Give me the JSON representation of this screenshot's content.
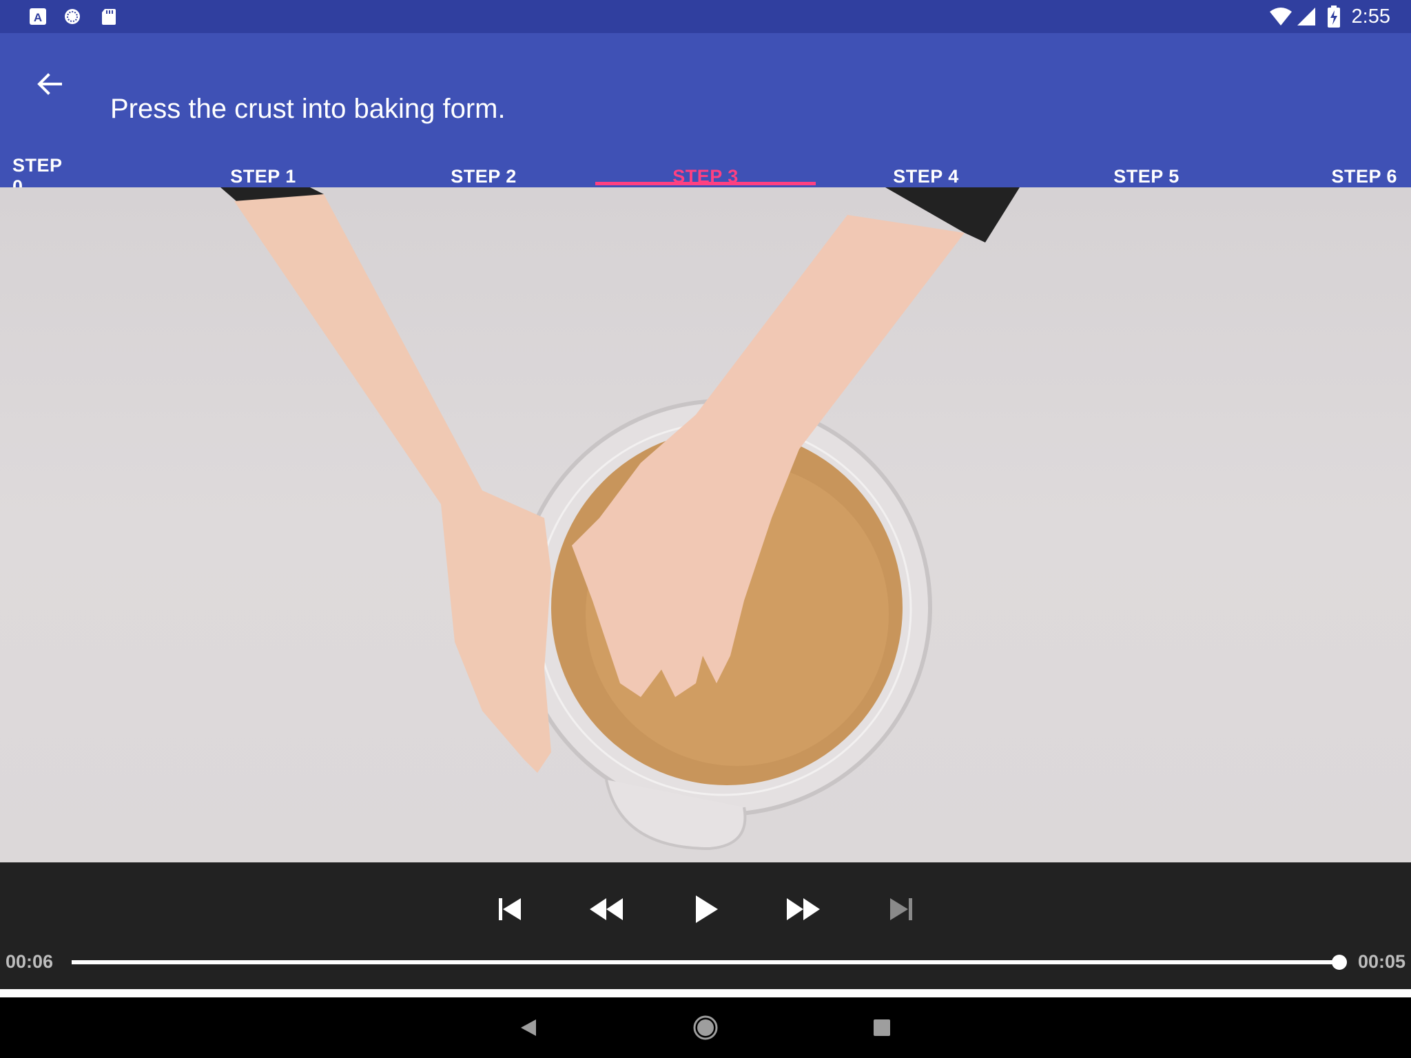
{
  "status_bar": {
    "time": "2:55",
    "left_icons": [
      "a-icon",
      "sync-icon",
      "sd-card-icon"
    ],
    "right_icons": [
      "wifi-icon",
      "signal-icon",
      "battery-charging-icon"
    ]
  },
  "app_bar": {
    "title": "Press the crust into baking form.",
    "back_icon": "arrow-back-icon"
  },
  "tabs": [
    {
      "label": "STEP 0"
    },
    {
      "label": "STEP 1"
    },
    {
      "label": "STEP 2"
    },
    {
      "label": "STEP 3",
      "active": true
    },
    {
      "label": "STEP 4"
    },
    {
      "label": "STEP 5"
    },
    {
      "label": "STEP 6"
    }
  ],
  "colors": {
    "status_bar": "#303f9f",
    "primary": "#3f51b5",
    "accent": "#ff4081",
    "player_bg": "#222222"
  },
  "player": {
    "position": "00:06",
    "duration": "00:05",
    "progress_fraction": 1.0,
    "controls": [
      "skip-previous-icon",
      "rewind-icon",
      "play-icon",
      "fast-forward-icon",
      "skip-next-icon"
    ]
  },
  "nav_bar": {
    "buttons": [
      "nav-back-icon",
      "nav-home-icon",
      "nav-recents-icon"
    ]
  }
}
